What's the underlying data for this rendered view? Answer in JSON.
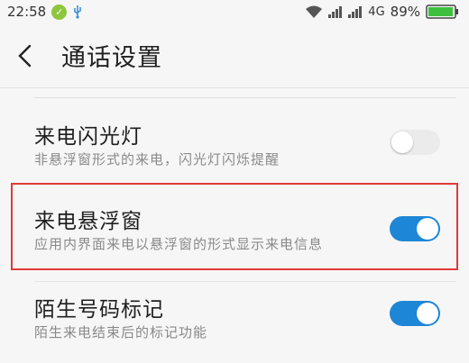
{
  "status_bar": {
    "time": "22:58",
    "network": "4G",
    "battery": "89%",
    "icons": [
      "app-notification-icon",
      "usb-icon",
      "wifi-icon",
      "signal-icon",
      "signal-icon",
      "battery-charging-icon"
    ]
  },
  "header": {
    "title": "通话设置"
  },
  "settings": [
    {
      "title": "来电闪光灯",
      "subtitle": "非悬浮窗形式的来电，闪光灯闪烁提醒",
      "enabled": false
    },
    {
      "title": "来电悬浮窗",
      "subtitle": "应用内界面来电以悬浮窗的形式显示来电信息",
      "enabled": true,
      "highlighted": true
    },
    {
      "title": "陌生号码标记",
      "subtitle": "陌生来电结束后的标记功能",
      "enabled": true
    }
  ],
  "colors": {
    "toggle_on": "#1e86d6",
    "toggle_off": "#ebebeb",
    "highlight_border": "#e03a3a",
    "battery": "#3fbf3f"
  }
}
